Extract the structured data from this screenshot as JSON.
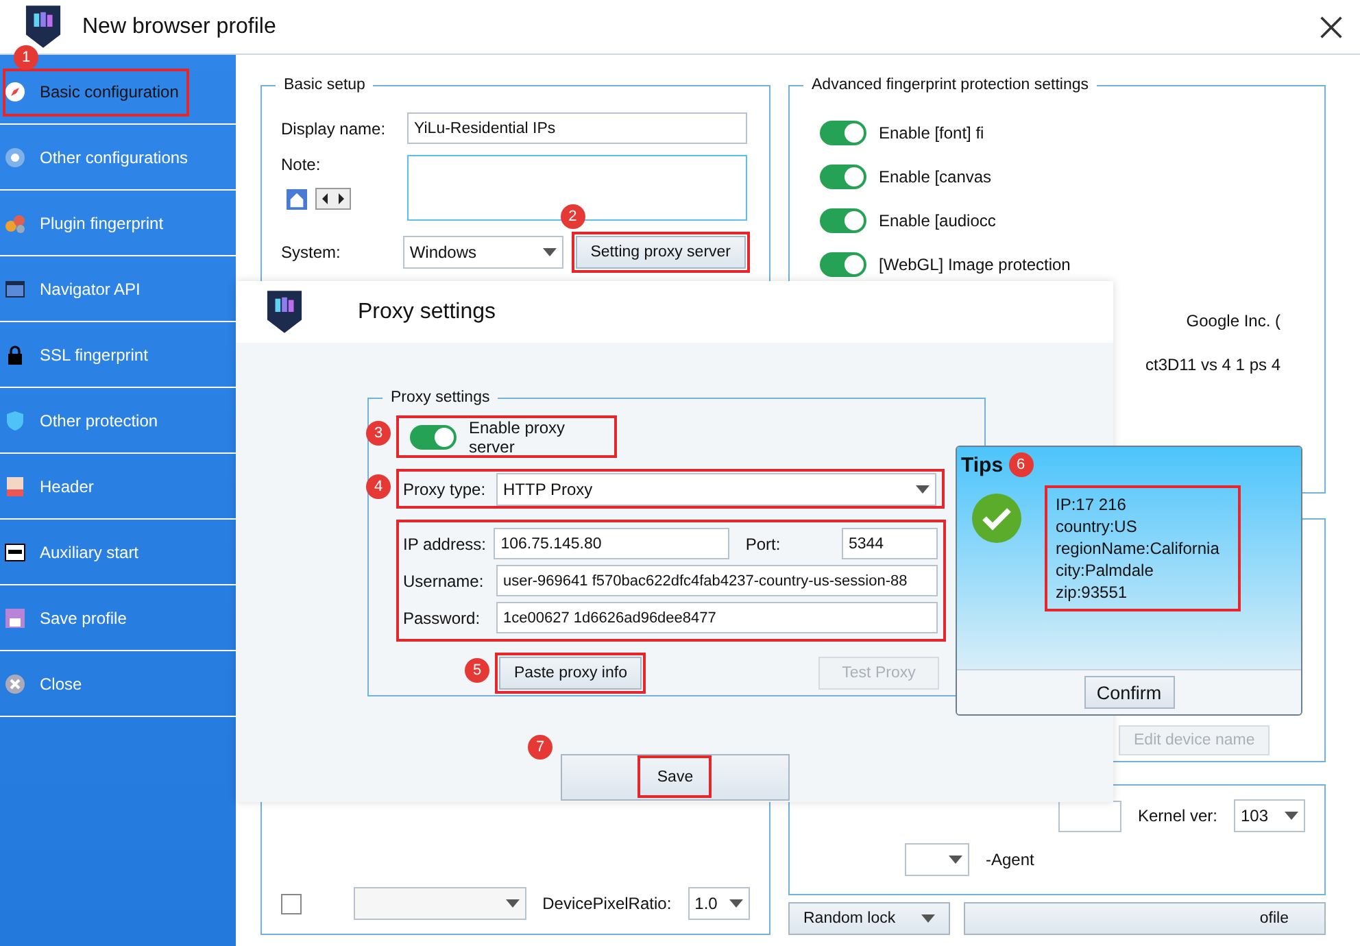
{
  "window": {
    "title": "New browser profile"
  },
  "sidebar": {
    "items": [
      {
        "label": "Basic configuration",
        "selected": true
      },
      {
        "label": "Other configurations",
        "selected": false
      },
      {
        "label": "Plugin fingerprint",
        "selected": false
      },
      {
        "label": "Navigator API",
        "selected": false
      },
      {
        "label": "SSL fingerprint",
        "selected": false
      },
      {
        "label": "Other protection",
        "selected": false
      },
      {
        "label": "Header",
        "selected": false
      },
      {
        "label": "Auxiliary start",
        "selected": false
      },
      {
        "label": "Save profile",
        "selected": false
      },
      {
        "label": "Close",
        "selected": false
      }
    ]
  },
  "basic_setup": {
    "title": "Basic setup",
    "display_name_label": "Display name:",
    "display_name": "YiLu-Residential IPs",
    "note_label": "Note:",
    "system_label": "System:",
    "system": "Windows",
    "proxy_button": "Setting proxy server"
  },
  "advanced": {
    "title": "Advanced fingerprint protection settings",
    "toggles": [
      {
        "label": "Enable [font] fi",
        "on": true
      },
      {
        "label": "Enable [canvas",
        "on": true
      },
      {
        "label": "Enable [audiocc",
        "on": true
      },
      {
        "label": "[WebGL] Image protection",
        "on": true
      }
    ],
    "webgl_lines": [
      "Google Inc. (",
      "ct3D11 vs 4 1 ps 4"
    ]
  },
  "device": {
    "edit_button": "Edit device name"
  },
  "kernel": {
    "label": "Kernel ver:",
    "value": "103",
    "agent_text": "-Agent"
  },
  "display": {
    "dpr_label": "DevicePixelRatio:",
    "dpr": "1.0",
    "emulation_checked": false
  },
  "bottom_buttons": {
    "random_lock": "Random lock",
    "profile": "ofile"
  },
  "proxy_dialog": {
    "title": "Proxy settings",
    "group_title": "Proxy settings",
    "enable": {
      "label": "Enable proxy server",
      "on": true
    },
    "type_label": "Proxy type:",
    "type": "HTTP Proxy",
    "ip_label": "IP address:",
    "ip": "106.75.145.80",
    "port_label": "Port:",
    "port": "5344",
    "username_label": "Username:",
    "username": "user-969641 f570bac622dfc4fab4237-country-us-session-88",
    "password_label": "Password:",
    "password": "1ce00627 1d6626ad96dee8477",
    "paste_button": "Paste proxy info",
    "test_button": {
      "label": "Test Proxy",
      "disabled": true
    },
    "save_button": "Save"
  },
  "tips": {
    "title": "Tips",
    "lines": [
      "IP:17 216",
      "country:US",
      "regionName:California",
      "city:Palmdale",
      "zip:93551"
    ],
    "confirm": "Confirm"
  },
  "annotations": [
    {
      "number": "1"
    },
    {
      "number": "2"
    },
    {
      "number": "3"
    },
    {
      "number": "4"
    },
    {
      "number": "5"
    },
    {
      "number": "6"
    },
    {
      "number": "7"
    }
  ]
}
